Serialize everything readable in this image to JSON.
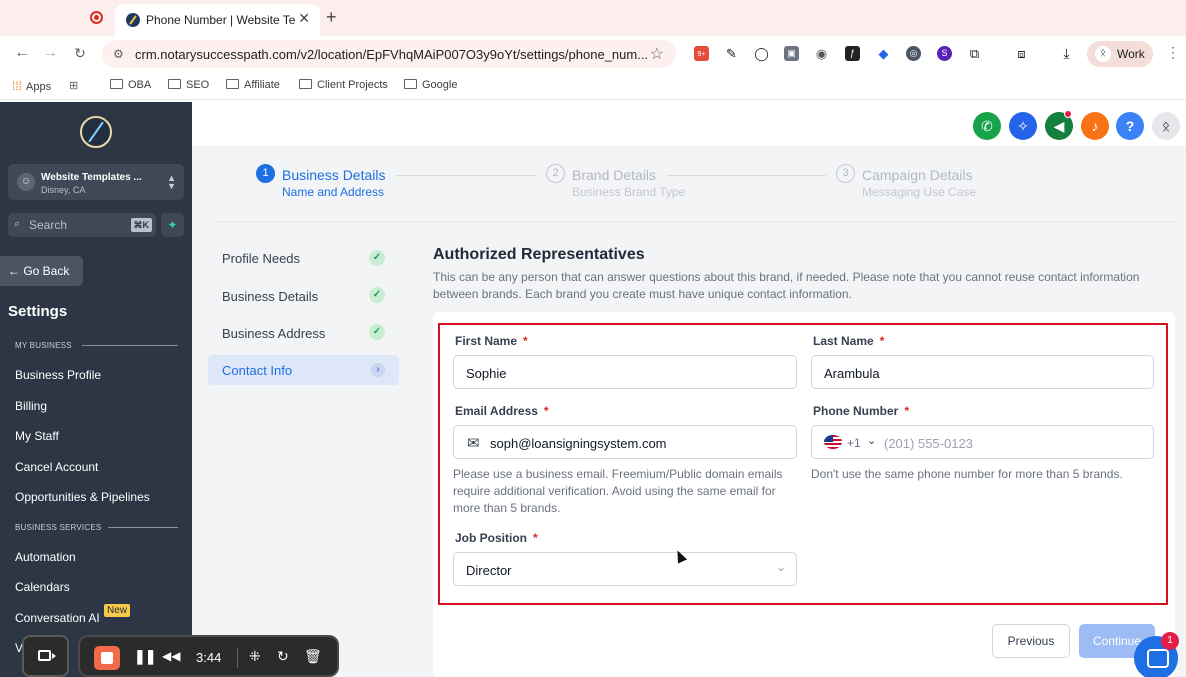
{
  "browser": {
    "tab_title": "Phone Number | Website Tem",
    "tab_close": "✕",
    "new_tab": "+",
    "url": "crm.notarysuccesspath.com/v2/location/EpFVhqMAiP007O3y9oYt/settings/phone_num...",
    "profile_label": "Work",
    "extension_badge": "9+",
    "bookmarks": [
      "Apps",
      "OBA",
      "SEO",
      "Affiliate",
      "Client Projects",
      "Google"
    ]
  },
  "sidebar": {
    "location_name": "Website Templates ...",
    "location_city": "Disney, CA",
    "search_placeholder": "Search",
    "search_shortcut": "⌘K",
    "go_back": "← Go Back",
    "title": "Settings",
    "section_my_business": "MY BUSINESS",
    "section_business_services": "BUSINESS SERVICES",
    "items": [
      "Business Profile",
      "Billing",
      "My Staff",
      "Cancel Account",
      "Opportunities & Pipelines",
      "Automation",
      "Calendars",
      "Conversation AI"
    ],
    "new_badge": "New",
    "partial_item": "Vo"
  },
  "stepper": {
    "steps": [
      {
        "num": "1",
        "title": "Business Details",
        "sub": "Name and Address"
      },
      {
        "num": "2",
        "title": "Brand Details",
        "sub": "Business Brand Type"
      },
      {
        "num": "3",
        "title": "Campaign Details",
        "sub": "Messaging Use Case"
      }
    ]
  },
  "left_nav": {
    "items": [
      "Profile Needs",
      "Business Details",
      "Business Address"
    ],
    "active": "Contact Info"
  },
  "section": {
    "title": "Authorized Representatives",
    "description": "This can be any person that can answer questions about this brand, if needed. Please note that you cannot reuse contact information between brands. Each brand you create must have unique contact information."
  },
  "form": {
    "first_name_label": "First Name",
    "first_name_value": "Sophie",
    "last_name_label": "Last Name",
    "last_name_value": "Arambula",
    "email_label": "Email Address",
    "email_value": "soph@loansigningsystem.com",
    "email_help": "Please use a business email. Freemium/Public domain emails require additional verification. Avoid using the same email for more than 5 brands.",
    "phone_label": "Phone Number",
    "phone_code": "+1",
    "phone_placeholder": "(201) 555-0123",
    "phone_help": "Don't use the same phone number for more than 5 brands.",
    "job_label": "Job Position",
    "job_value": "Director",
    "required_mark": "*"
  },
  "actions": {
    "previous": "Previous",
    "continue": "Continue"
  },
  "chat_badge": "1",
  "recorder": {
    "time": "3:44"
  },
  "colors": {
    "primary": "#1d6fe3",
    "sidebar_bg": "#2c3644",
    "highlight_box": "#d80f1c",
    "success": "#1f9d55"
  }
}
